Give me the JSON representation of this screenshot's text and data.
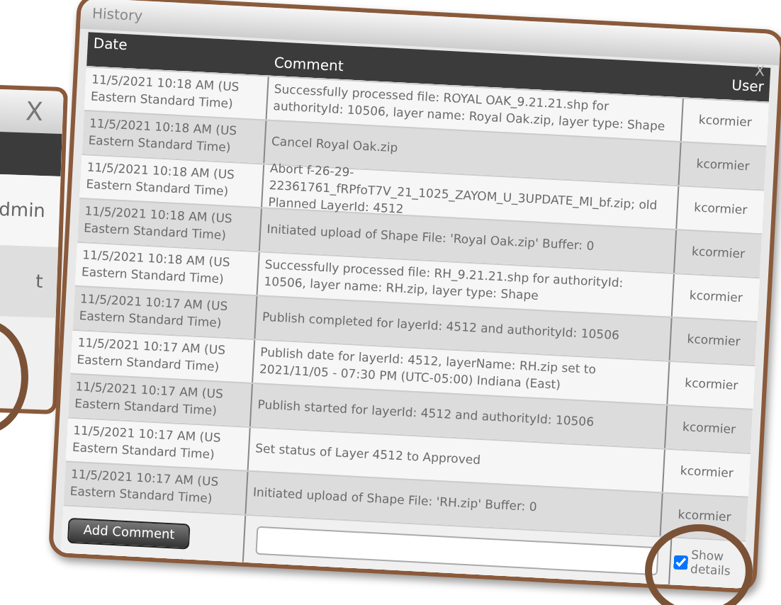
{
  "background_window": {
    "close": "X",
    "texts": [
      "dmin",
      "t"
    ]
  },
  "dialog": {
    "title": "History",
    "close": "X",
    "columns": [
      "Date",
      "Comment",
      "User"
    ],
    "rows": [
      {
        "date": "11/5/2021 10:18 AM (US Eastern Standard Time)",
        "comment": "Successfully processed file: ROYAL OAK_9.21.21.shp for authorityId: 10506, layer name: Royal Oak.zip, layer type: Shape",
        "user": "kcormier"
      },
      {
        "date": "11/5/2021 10:18 AM (US Eastern Standard Time)",
        "comment": "Cancel Royal Oak.zip",
        "user": "kcormier"
      },
      {
        "date": "11/5/2021 10:18 AM (US Eastern Standard Time)",
        "comment": "Abort f-26-29-22361761_fRPfoT7V_21_1025_ZAYOM_U_3UPDATE_MI_bf.zip; old Planned LayerId: 4512",
        "user": "kcormier"
      },
      {
        "date": "11/5/2021 10:18 AM (US Eastern Standard Time)",
        "comment": "Initiated upload of Shape File: 'Royal Oak.zip' Buffer: 0",
        "user": "kcormier"
      },
      {
        "date": "11/5/2021 10:18 AM (US Eastern Standard Time)",
        "comment": "Successfully processed file: RH_9.21.21.shp for authorityId: 10506, layer name: RH.zip, layer type: Shape",
        "user": "kcormier"
      },
      {
        "date": "11/5/2021 10:17 AM (US Eastern Standard Time)",
        "comment": "Publish completed for layerId: 4512 and authorityId: 10506",
        "user": "kcormier"
      },
      {
        "date": "11/5/2021 10:17 AM (US Eastern Standard Time)",
        "comment": "Publish date for layerId: 4512, layerName: RH.zip set to 2021/11/05 - 07:30 PM (UTC-05:00) Indiana (East)",
        "user": "kcormier"
      },
      {
        "date": "11/5/2021 10:17 AM (US Eastern Standard Time)",
        "comment": "Publish started for layerId: 4512 and authorityId: 10506",
        "user": "kcormier"
      },
      {
        "date": "11/5/2021 10:17 AM (US Eastern Standard Time)",
        "comment": "Set status of Layer 4512 to Approved",
        "user": "kcormier"
      },
      {
        "date": "11/5/2021 10:17 AM (US Eastern Standard Time)",
        "comment": "Initiated upload of Shape File: 'RH.zip' Buffer: 0",
        "user": "kcormier"
      }
    ],
    "add_comment_button": "Add Comment",
    "show_details": {
      "label": "Show details",
      "checked": true
    }
  }
}
